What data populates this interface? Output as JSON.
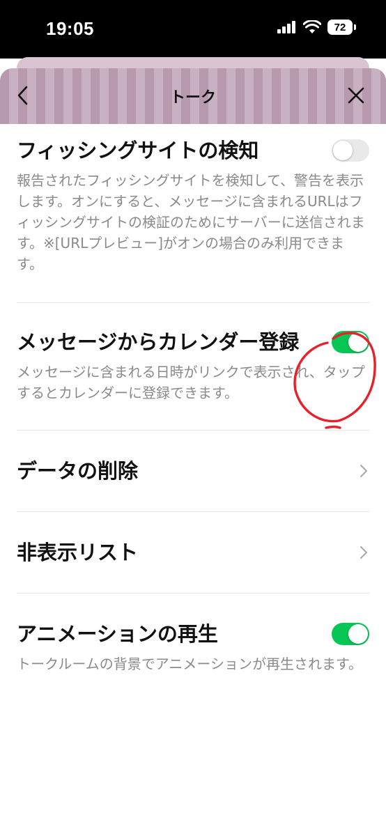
{
  "status_bar": {
    "time": "19:05",
    "battery": "72"
  },
  "nav": {
    "title": "トーク"
  },
  "settings": {
    "phishing": {
      "title": "フィッシングサイトの検知",
      "description": "報告されたフィッシングサイトを検知して、警告を表示します。オンにすると、メッセージに含まれるURLはフィッシングサイトの検証のためにサーバーに送信されます。※[URLプレビュー]がオンの場合のみ利用できます。",
      "enabled": false
    },
    "calendar": {
      "title": "メッセージからカレンダー登録",
      "description": "メッセージに含まれる日時がリンクで表示され、タップするとカレンダーに登録できます。",
      "enabled": true
    },
    "delete_data": {
      "title": "データの削除"
    },
    "hidden_list": {
      "title": "非表示リスト"
    },
    "animation": {
      "title": "アニメーションの再生",
      "description": "トークルームの背景でアニメーションが再生されます。",
      "enabled": true
    }
  },
  "colors": {
    "toggle_on": "#06c755",
    "toggle_off": "#e9e9ea",
    "annotation_circle": "#e8202a",
    "header_stripe_dark": "#b79aae",
    "header_stripe_light": "#c9b0c2"
  },
  "icons": {
    "back": "chevron-left-icon",
    "close": "close-icon",
    "row_arrow": "chevron-right-icon"
  }
}
